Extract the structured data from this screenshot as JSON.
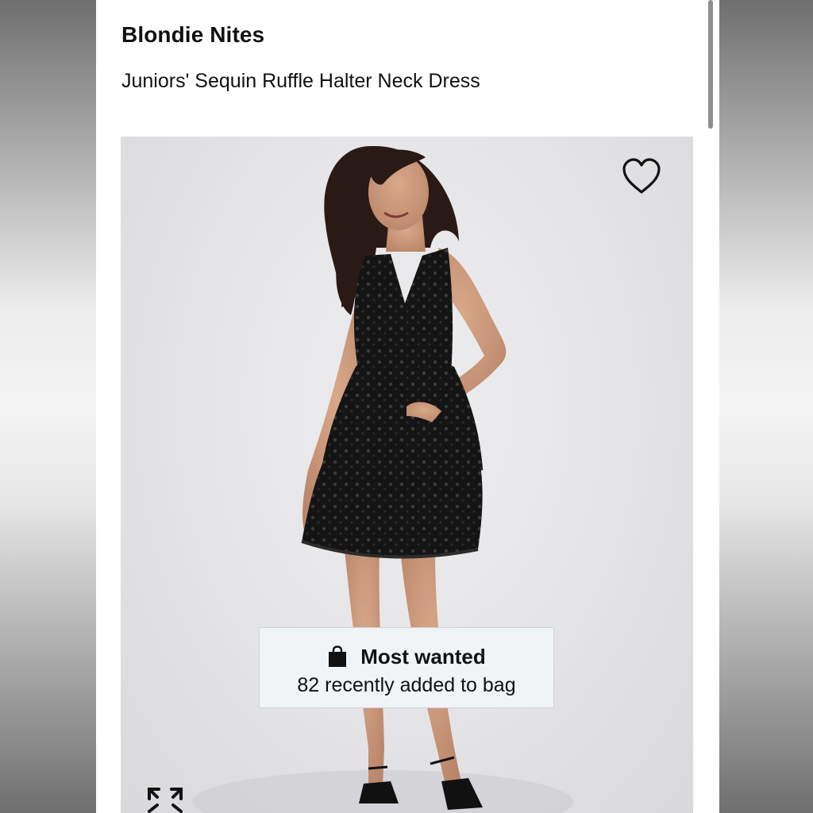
{
  "product": {
    "brand": "Blondie Nites",
    "name": "Juniors' Sequin Ruffle Halter Neck Dress"
  },
  "badge": {
    "title": "Most wanted",
    "subtitle": "82 recently added to bag"
  },
  "icons": {
    "favorite": "heart-outline-icon",
    "bag": "shopping-bag-icon",
    "expand": "expand-arrows-icon"
  },
  "colors": {
    "text": "#111111",
    "badge_background": "#f1f4f7",
    "image_background": "#e4e4e7"
  }
}
